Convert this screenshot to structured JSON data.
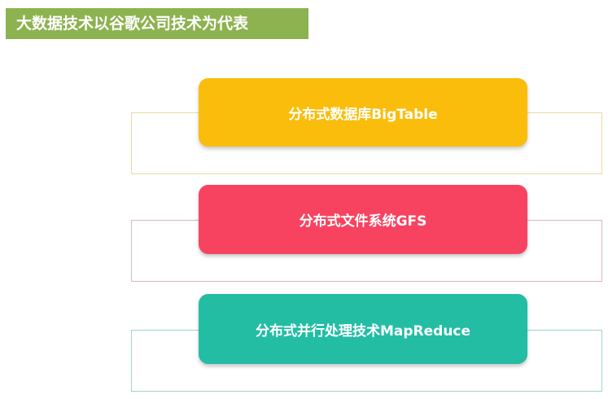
{
  "title": "大数据技术以谷歌公司技术为代表",
  "colors": {
    "title_bg": "#8db250",
    "bar_1": "#fbbd0b",
    "bar_2": "#f84360",
    "bar_3": "#23bda4",
    "outline_1": "#ebd9a2",
    "outline_2": "#dab4c4",
    "outline_3": "#9fd3d1"
  },
  "items": [
    {
      "label": "分布式数据库BigTable"
    },
    {
      "label": "分布式文件系统GFS"
    },
    {
      "label": "分布式并行处理技术MapReduce"
    }
  ]
}
